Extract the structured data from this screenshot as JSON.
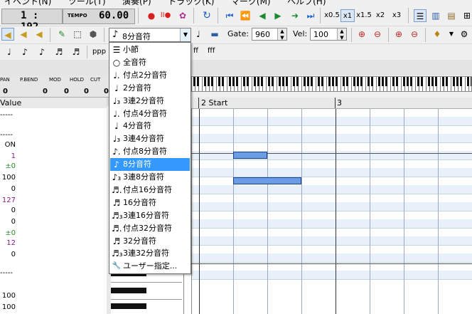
{
  "menubar": [
    "イベント(N)",
    "ツール(T)",
    "演奏(P)",
    "トラック(K)",
    "マーク(M)",
    "ヘルプ(H)"
  ],
  "transport": {
    "position": "1 : 192",
    "tempo_label": "TEMPO",
    "tempo_value": "60.00"
  },
  "speed_buttons": [
    "x0.5",
    "x1",
    "x1.5",
    "x2",
    "x3"
  ],
  "note_combo": {
    "icon": "eighth-note-icon",
    "value": "8分音符"
  },
  "gate": {
    "label": "Gate:",
    "value": "960"
  },
  "vel": {
    "label": "Vel:",
    "value": "100"
  },
  "dynamics": [
    "ppp",
    "ff",
    "fff"
  ],
  "track_header": {
    "columns": [
      "PAN",
      "P.BEND",
      "MOD",
      "HOLD",
      "CUT"
    ],
    "values": [
      "0",
      "0",
      "0",
      "0",
      "0"
    ]
  },
  "value_header": "Value",
  "left_values": [
    "-----",
    "-----",
    "ON",
    "1",
    "±0",
    "100",
    "0",
    "127",
    "0",
    "0",
    "±0",
    "12",
    "0",
    "-----",
    "100",
    "100"
  ],
  "roll_header": {
    "measure2": "2 Start",
    "measure3": "3"
  },
  "dropdown_items": [
    {
      "icon": "measure-icon",
      "label": "小節"
    },
    {
      "icon": "whole-note-icon",
      "label": "全音符"
    },
    {
      "icon": "dotted-half-note-icon",
      "label": "付点2分音符"
    },
    {
      "icon": "half-note-icon",
      "label": "2分音符"
    },
    {
      "icon": "half-triplet-icon",
      "label": "3連2分音符"
    },
    {
      "icon": "dotted-quarter-note-icon",
      "label": "付点4分音符"
    },
    {
      "icon": "quarter-note-icon",
      "label": "4分音符"
    },
    {
      "icon": "quarter-triplet-icon",
      "label": "3連4分音符"
    },
    {
      "icon": "dotted-eighth-note-icon",
      "label": "付点8分音符"
    },
    {
      "icon": "eighth-note-icon",
      "label": "8分音符"
    },
    {
      "icon": "eighth-triplet-icon",
      "label": "3連8分音符"
    },
    {
      "icon": "dotted-sixteenth-note-icon",
      "label": "付点16分音符"
    },
    {
      "icon": "sixteenth-note-icon",
      "label": "16分音符"
    },
    {
      "icon": "sixteenth-triplet-icon",
      "label": "3連16分音符"
    },
    {
      "icon": "dotted-thirtysecond-note-icon",
      "label": "付点32分音符"
    },
    {
      "icon": "thirtysecond-note-icon",
      "label": "32分音符"
    },
    {
      "icon": "thirtysecond-triplet-icon",
      "label": "3連32分音符"
    },
    {
      "icon": "wrench-icon",
      "label": "ユーザー指定..."
    }
  ],
  "selected_item": "8分音符",
  "colors": {
    "selection": "#3399ff",
    "note_fill": "#6b9de6",
    "note_border": "#1b3f86"
  }
}
